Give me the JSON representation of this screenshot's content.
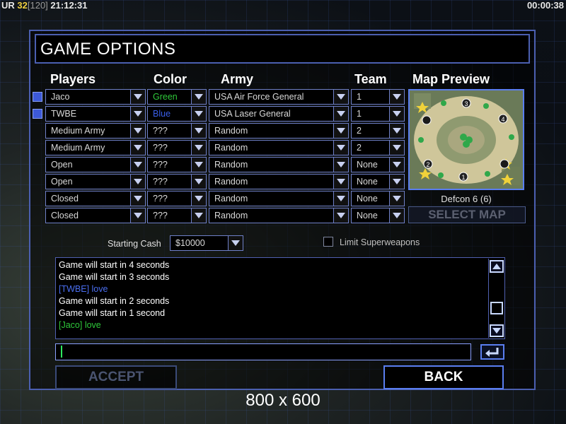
{
  "hud": {
    "left_prefix": "UR",
    "left_num": "32",
    "left_bracket": "[120]",
    "left_time": "21:12:31",
    "right_time": "00:00:38"
  },
  "title": "GAME OPTIONS",
  "headers": {
    "players": "Players",
    "color": "Color",
    "army": "Army",
    "team": "Team",
    "map_preview": "Map Preview"
  },
  "slots": [
    {
      "player": "Jaco",
      "color": "Green",
      "color_hex": "#2ec83a",
      "army": "USA Air Force General",
      "team": "1",
      "marker": true
    },
    {
      "player": "TWBE",
      "color": "Blue",
      "color_hex": "#3a5ee8",
      "army": "USA Laser General",
      "team": "1",
      "marker": true
    },
    {
      "player": "Medium Army",
      "color": "???",
      "color_hex": "#d8d8d8",
      "army": "Random",
      "team": "2",
      "marker": false
    },
    {
      "player": "Medium Army",
      "color": "???",
      "color_hex": "#d8d8d8",
      "army": "Random",
      "team": "2",
      "marker": false
    },
    {
      "player": "Open",
      "color": "???",
      "color_hex": "#d8d8d8",
      "army": "Random",
      "team": "None",
      "marker": false
    },
    {
      "player": "Open",
      "color": "???",
      "color_hex": "#d8d8d8",
      "army": "Random",
      "team": "None",
      "marker": false
    },
    {
      "player": "Closed",
      "color": "???",
      "color_hex": "#d8d8d8",
      "army": "Random",
      "team": "None",
      "marker": false
    },
    {
      "player": "Closed",
      "color": "???",
      "color_hex": "#d8d8d8",
      "army": "Random",
      "team": "None",
      "marker": false
    }
  ],
  "map": {
    "name": "Defcon 6 (6)",
    "select_label": "SELECT MAP",
    "start_labels": [
      "1",
      "2",
      "3",
      "4"
    ]
  },
  "starting_cash_label": "Starting Cash",
  "starting_cash_value": "$10000",
  "limit_superweapons_label": "Limit Superweapons",
  "limit_superweapons_checked": false,
  "chat": [
    {
      "text": "Game will start in 4 seconds",
      "color": "#ffffff"
    },
    {
      "text": "Game will start in 3 seconds",
      "color": "#ffffff"
    },
    {
      "text": "[TWBE] love",
      "color": "#4a6ef0"
    },
    {
      "text": "Game will start in 2 seconds",
      "color": "#ffffff"
    },
    {
      "text": "Game will start in 1 second",
      "color": "#ffffff"
    },
    {
      "text": "[Jaco] love",
      "color": "#2ec83a"
    }
  ],
  "chat_input_value": "",
  "accept_label": "ACCEPT",
  "back_label": "BACK",
  "resolution_label": "800 x 600"
}
